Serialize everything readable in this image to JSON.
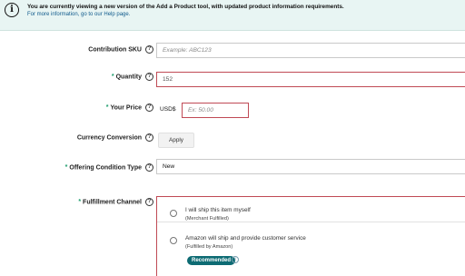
{
  "banner": {
    "message": "You are currently viewing a new version of the Add a Product tool, with updated product information requirements.",
    "help_link": "For more information, go to our Help page.",
    "info_icon": "i"
  },
  "form": {
    "contribution_sku": {
      "label": "Contribution SKU",
      "placeholder": "Example: ABC123",
      "required": false
    },
    "quantity": {
      "label": "Quantity",
      "value": "152",
      "required": true,
      "required_mark": "*"
    },
    "your_price": {
      "label": "Your Price",
      "currency": "USD$",
      "placeholder": "Ex: 50.00",
      "required": true,
      "required_mark": "*"
    },
    "currency_conversion": {
      "label": "Currency Conversion",
      "button": "Apply"
    },
    "offering_condition_type": {
      "label": "Offering Condition Type",
      "value": "New",
      "required": true,
      "required_mark": "*"
    },
    "fulfillment_channel": {
      "label": "Fulfillment Channel",
      "required": true,
      "required_mark": "*",
      "options": [
        {
          "title": "I will ship this item myself",
          "subtitle": "(Merchant Fulfilled)"
        },
        {
          "title": "Amazon will ship and provide customer service",
          "subtitle": "(Fulfilled by Amazon)",
          "badge": "Recommended"
        }
      ]
    },
    "help_glyph": "?"
  },
  "colors": {
    "banner_bg": "#e8f5f3",
    "error_border": "#c04a55",
    "required_mark": "#1a9c6b",
    "badge_bg": "#0d6b73"
  }
}
